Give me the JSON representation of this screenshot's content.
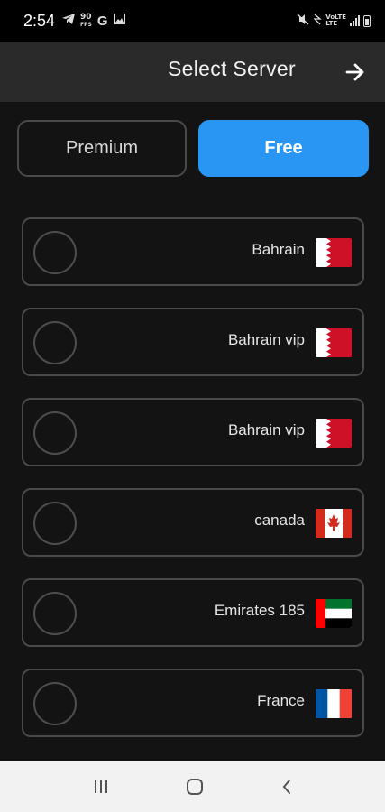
{
  "status_bar": {
    "time": "2:54",
    "left_icons": [
      "telegram-icon",
      "fps-90-icon",
      "google-icon",
      "gallery-icon"
    ],
    "right_icons": [
      "mute-icon",
      "wifi-icon",
      "lte-icon",
      "signal-icon",
      "battery-icon"
    ]
  },
  "header": {
    "title": "Select Server",
    "action_icon": "arrow-right-icon"
  },
  "tabs": [
    {
      "label": "Premium",
      "selected": false
    },
    {
      "label": "Free",
      "selected": true
    }
  ],
  "servers": [
    {
      "name": "Bahrain",
      "flag": "bahrain",
      "selected": false
    },
    {
      "name": "Bahrain vip",
      "flag": "bahrain",
      "selected": false
    },
    {
      "name": "Bahrain vip",
      "flag": "bahrain",
      "selected": false
    },
    {
      "name": "canada",
      "flag": "canada",
      "selected": false
    },
    {
      "name": "Emirates 185",
      "flag": "uae",
      "selected": false
    },
    {
      "name": "France",
      "flag": "france",
      "selected": false
    }
  ],
  "nav_bar": {
    "icons": [
      "recent-apps-icon",
      "home-icon",
      "back-icon"
    ]
  },
  "colors": {
    "background": "#131313",
    "header": "#2a2a2a",
    "accent": "#2a96f4",
    "border": "#4a4a4a"
  }
}
